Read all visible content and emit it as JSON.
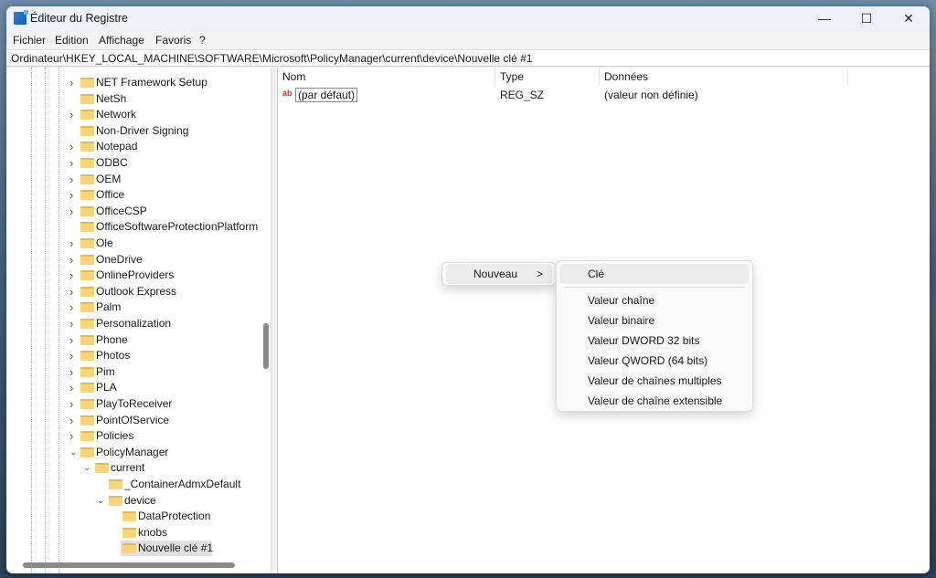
{
  "window": {
    "title": "Éditeur du Registre",
    "minimize": "—",
    "maximize": "☐",
    "close": "✕"
  },
  "menu": [
    "Fichier",
    "Edition",
    "Affichage",
    "Favoris",
    "?"
  ],
  "address": "Ordinateur\\HKEY_LOCAL_MACHINE\\SOFTWARE\\Microsoft\\PolicyManager\\current\\device\\Nouvelle clé #1",
  "tree": [
    {
      "label": "NET Framework Setup",
      "level": 1,
      "expander": "collapsed"
    },
    {
      "label": "NetSh",
      "level": 1,
      "expander": "none"
    },
    {
      "label": "Network",
      "level": 1,
      "expander": "collapsed"
    },
    {
      "label": "Non-Driver Signing",
      "level": 1,
      "expander": "none"
    },
    {
      "label": "Notepad",
      "level": 1,
      "expander": "collapsed"
    },
    {
      "label": "ODBC",
      "level": 1,
      "expander": "collapsed"
    },
    {
      "label": "OEM",
      "level": 1,
      "expander": "collapsed"
    },
    {
      "label": "Office",
      "level": 1,
      "expander": "collapsed"
    },
    {
      "label": "OfficeCSP",
      "level": 1,
      "expander": "collapsed"
    },
    {
      "label": "OfficeSoftwareProtectionPlatform",
      "level": 1,
      "expander": "none"
    },
    {
      "label": "Ole",
      "level": 1,
      "expander": "collapsed"
    },
    {
      "label": "OneDrive",
      "level": 1,
      "expander": "collapsed"
    },
    {
      "label": "OnlineProviders",
      "level": 1,
      "expander": "collapsed"
    },
    {
      "label": "Outlook Express",
      "level": 1,
      "expander": "collapsed"
    },
    {
      "label": "Palm",
      "level": 1,
      "expander": "collapsed"
    },
    {
      "label": "Personalization",
      "level": 1,
      "expander": "collapsed"
    },
    {
      "label": "Phone",
      "level": 1,
      "expander": "collapsed"
    },
    {
      "label": "Photos",
      "level": 1,
      "expander": "collapsed"
    },
    {
      "label": "Pim",
      "level": 1,
      "expander": "collapsed"
    },
    {
      "label": "PLA",
      "level": 1,
      "expander": "collapsed"
    },
    {
      "label": "PlayToReceiver",
      "level": 1,
      "expander": "collapsed"
    },
    {
      "label": "PointOfService",
      "level": 1,
      "expander": "collapsed"
    },
    {
      "label": "Policies",
      "level": 1,
      "expander": "collapsed"
    },
    {
      "label": "PolicyManager",
      "level": 1,
      "expander": "expanded"
    },
    {
      "label": "current",
      "level": 2,
      "expander": "expanded"
    },
    {
      "label": "_ContainerAdmxDefault",
      "level": 3,
      "expander": "none"
    },
    {
      "label": "device",
      "level": 3,
      "expander": "expanded"
    },
    {
      "label": "DataProtection",
      "level": 4,
      "expander": "none"
    },
    {
      "label": "knobs",
      "level": 4,
      "expander": "none"
    },
    {
      "label": "Nouvelle clé #1",
      "level": 4,
      "expander": "none",
      "selected": true
    }
  ],
  "list": {
    "columns": [
      "Nom",
      "Type",
      "Données"
    ],
    "rows": [
      {
        "name": "(par défaut)",
        "type": "REG_SZ",
        "data": "(valeur non définie)",
        "icon": "string-value-icon"
      }
    ]
  },
  "context_menu": {
    "item": "Nouveau",
    "arrow": ">"
  },
  "submenu": {
    "items": [
      "Clé",
      "Valeur chaîne",
      "Valeur binaire",
      "Valeur DWORD 32 bits",
      "Valeur QWORD (64 bits)",
      "Valeur de chaînes multiples",
      "Valeur de chaîne extensible"
    ]
  }
}
